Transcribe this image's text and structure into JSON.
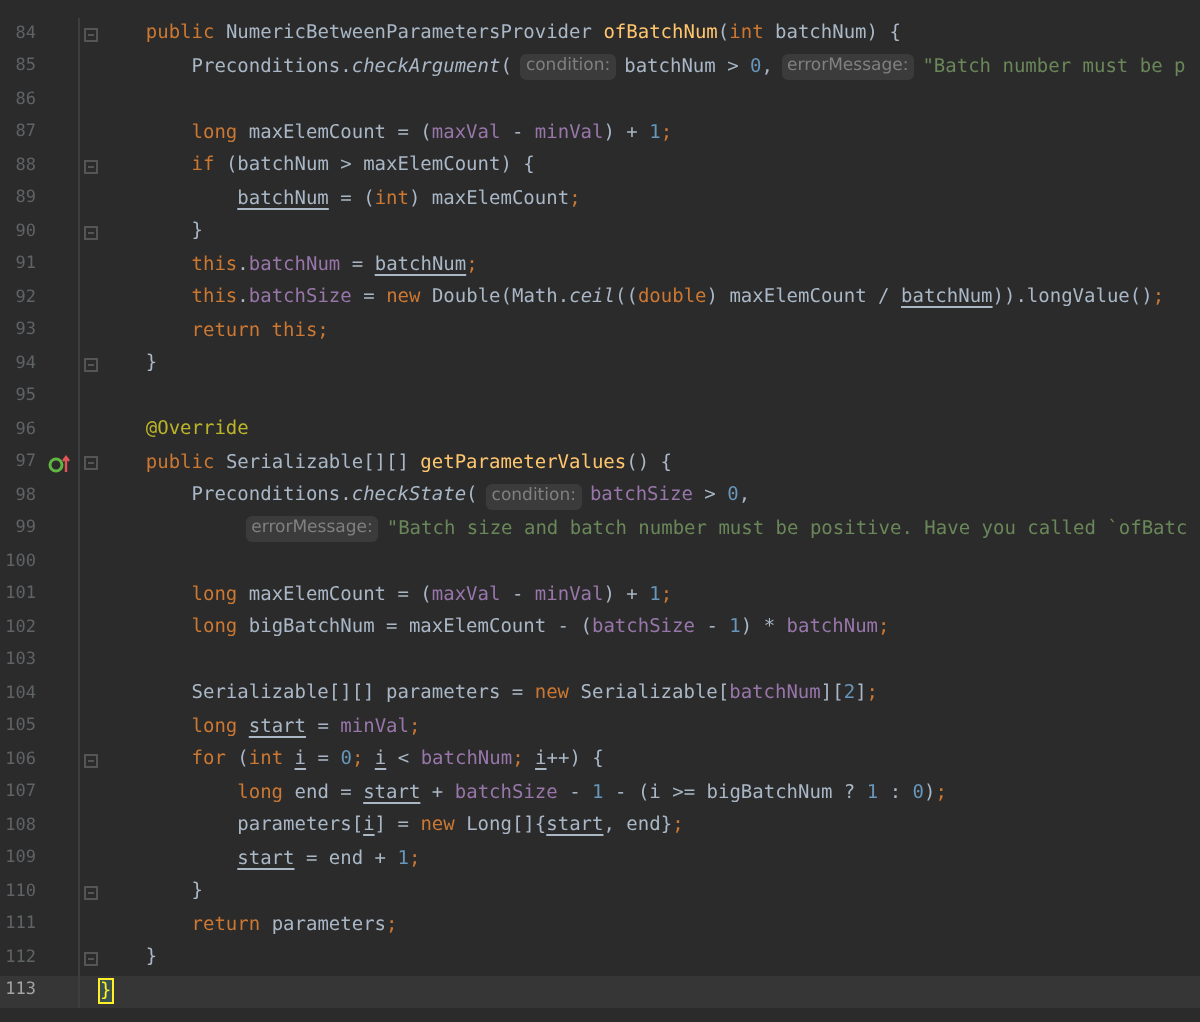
{
  "editor": {
    "lines": [
      {
        "number": "84",
        "fold": true,
        "current": false,
        "tokens": [
          {
            "kind": "keyword",
            "text": "    public "
          },
          {
            "kind": "plain",
            "text": "NumericBetweenParametersProvider "
          },
          {
            "kind": "method",
            "text": "ofBatchNum"
          },
          {
            "kind": "plain",
            "text": "("
          },
          {
            "kind": "keyword",
            "text": "int "
          },
          {
            "kind": "plain",
            "text": "batchNum) {"
          }
        ]
      },
      {
        "number": "85",
        "fold": false,
        "current": false,
        "tokens": [
          {
            "kind": "plain",
            "text": "        Preconditions."
          },
          {
            "kind": "static",
            "text": "checkArgument"
          },
          {
            "kind": "plain",
            "text": "("
          },
          {
            "kind": "hint",
            "text": "condition:"
          },
          {
            "kind": "plain",
            "text": "batchNum > "
          },
          {
            "kind": "number",
            "text": "0"
          },
          {
            "kind": "plain",
            "text": ","
          },
          {
            "kind": "hint",
            "text": "errorMessage:"
          },
          {
            "kind": "string",
            "text": "\"Batch number must be p"
          }
        ]
      },
      {
        "number": "86",
        "fold": false,
        "current": false
      },
      {
        "number": "87",
        "fold": false,
        "current": false,
        "tokens": [
          {
            "kind": "keyword",
            "text": "        long "
          },
          {
            "kind": "plain",
            "text": "maxElemCount = ("
          },
          {
            "kind": "field",
            "text": "maxVal"
          },
          {
            "kind": "plain",
            "text": " - "
          },
          {
            "kind": "field",
            "text": "minVal"
          },
          {
            "kind": "plain",
            "text": ") + "
          },
          {
            "kind": "number",
            "text": "1"
          },
          {
            "kind": "keyword",
            "text": ";"
          }
        ]
      },
      {
        "number": "88",
        "fold": true,
        "current": false,
        "tokens": [
          {
            "kind": "keyword",
            "text": "        if "
          },
          {
            "kind": "plain",
            "text": "(batchNum > maxElemCount) {"
          }
        ]
      },
      {
        "number": "89",
        "fold": false,
        "current": false,
        "tokens": [
          {
            "kind": "reassigned",
            "text": "            batchNum"
          },
          {
            "kind": "plain",
            "text": " = ("
          },
          {
            "kind": "keyword",
            "text": "int"
          },
          {
            "kind": "plain",
            "text": ") maxElemCount"
          },
          {
            "kind": "keyword",
            "text": ";"
          }
        ]
      },
      {
        "number": "90",
        "fold": true,
        "current": false,
        "tokens": [
          {
            "kind": "plain",
            "text": "        }"
          }
        ]
      },
      {
        "number": "91",
        "fold": false,
        "current": false,
        "tokens": [
          {
            "kind": "keyword",
            "text": "        this"
          },
          {
            "kind": "plain",
            "text": "."
          },
          {
            "kind": "field",
            "text": "batchNum"
          },
          {
            "kind": "plain",
            "text": " = "
          },
          {
            "kind": "reassigned",
            "text": "batchNum"
          },
          {
            "kind": "keyword",
            "text": ";"
          }
        ]
      },
      {
        "number": "92",
        "fold": false,
        "current": false,
        "tokens": [
          {
            "kind": "keyword",
            "text": "        this"
          },
          {
            "kind": "plain",
            "text": "."
          },
          {
            "kind": "field",
            "text": "batchSize"
          },
          {
            "kind": "plain",
            "text": " = "
          },
          {
            "kind": "keyword",
            "text": "new "
          },
          {
            "kind": "plain",
            "text": "Double(Math."
          },
          {
            "kind": "static",
            "text": "ceil"
          },
          {
            "kind": "plain",
            "text": "(("
          },
          {
            "kind": "keyword",
            "text": "double"
          },
          {
            "kind": "plain",
            "text": ") maxElemCount / "
          },
          {
            "kind": "reassigned",
            "text": "batchNum"
          },
          {
            "kind": "plain",
            "text": ")).longValue()"
          },
          {
            "kind": "keyword",
            "text": ";"
          }
        ]
      },
      {
        "number": "93",
        "fold": false,
        "current": false,
        "tokens": [
          {
            "kind": "keyword",
            "text": "        return this;"
          }
        ]
      },
      {
        "number": "94",
        "fold": true,
        "current": false,
        "tokens": [
          {
            "kind": "plain",
            "text": "    }"
          }
        ]
      },
      {
        "number": "95",
        "fold": false,
        "current": false
      },
      {
        "number": "96",
        "fold": false,
        "current": false,
        "tokens": [
          {
            "kind": "annotation",
            "text": "    @Override"
          }
        ]
      },
      {
        "number": "97",
        "fold": true,
        "current": false,
        "override": true,
        "tokens": [
          {
            "kind": "keyword",
            "text": "    public "
          },
          {
            "kind": "plain",
            "text": "Serializable[][] "
          },
          {
            "kind": "method",
            "text": "getParameterValues"
          },
          {
            "kind": "plain",
            "text": "() {"
          }
        ]
      },
      {
        "number": "98",
        "fold": false,
        "current": false,
        "tokens": [
          {
            "kind": "plain",
            "text": "        Preconditions."
          },
          {
            "kind": "static",
            "text": "checkState"
          },
          {
            "kind": "plain",
            "text": "("
          },
          {
            "kind": "hint",
            "text": "condition:"
          },
          {
            "kind": "field",
            "text": "batchSize"
          },
          {
            "kind": "plain",
            "text": " > "
          },
          {
            "kind": "number",
            "text": "0"
          },
          {
            "kind": "plain",
            "text": ","
          }
        ]
      },
      {
        "number": "99",
        "fold": false,
        "current": false,
        "tokens": [
          {
            "kind": "hint",
            "text": "            errorMessage:"
          },
          {
            "kind": "string",
            "text": "\"Batch size and batch number must be positive. Have you called `ofBatc"
          }
        ]
      },
      {
        "number": "100",
        "fold": false,
        "current": false
      },
      {
        "number": "101",
        "fold": false,
        "current": false,
        "tokens": [
          {
            "kind": "keyword",
            "text": "        long "
          },
          {
            "kind": "plain",
            "text": "maxElemCount = ("
          },
          {
            "kind": "field",
            "text": "maxVal"
          },
          {
            "kind": "plain",
            "text": " - "
          },
          {
            "kind": "field",
            "text": "minVal"
          },
          {
            "kind": "plain",
            "text": ") + "
          },
          {
            "kind": "number",
            "text": "1"
          },
          {
            "kind": "keyword",
            "text": ";"
          }
        ]
      },
      {
        "number": "102",
        "fold": false,
        "current": false,
        "tokens": [
          {
            "kind": "keyword",
            "text": "        long "
          },
          {
            "kind": "plain",
            "text": "bigBatchNum = maxElemCount - ("
          },
          {
            "kind": "field",
            "text": "batchSize"
          },
          {
            "kind": "plain",
            "text": " - "
          },
          {
            "kind": "number",
            "text": "1"
          },
          {
            "kind": "plain",
            "text": ") * "
          },
          {
            "kind": "field",
            "text": "batchNum"
          },
          {
            "kind": "keyword",
            "text": ";"
          }
        ]
      },
      {
        "number": "103",
        "fold": false,
        "current": false
      },
      {
        "number": "104",
        "fold": false,
        "current": false,
        "tokens": [
          {
            "kind": "plain",
            "text": "        Serializable[][] parameters = "
          },
          {
            "kind": "keyword",
            "text": "new "
          },
          {
            "kind": "plain",
            "text": "Serializable["
          },
          {
            "kind": "field",
            "text": "batchNum"
          },
          {
            "kind": "plain",
            "text": "]["
          },
          {
            "kind": "number",
            "text": "2"
          },
          {
            "kind": "plain",
            "text": "]"
          },
          {
            "kind": "keyword",
            "text": ";"
          }
        ]
      },
      {
        "number": "105",
        "fold": false,
        "current": false,
        "tokens": [
          {
            "kind": "keyword",
            "text": "        long "
          },
          {
            "kind": "reassigned",
            "text": "start"
          },
          {
            "kind": "plain",
            "text": " = "
          },
          {
            "kind": "field",
            "text": "minVal"
          },
          {
            "kind": "keyword",
            "text": ";"
          }
        ]
      },
      {
        "number": "106",
        "fold": true,
        "current": false,
        "tokens": [
          {
            "kind": "keyword",
            "text": "        for "
          },
          {
            "kind": "plain",
            "text": "("
          },
          {
            "kind": "keyword",
            "text": "int "
          },
          {
            "kind": "reassigned",
            "text": "i"
          },
          {
            "kind": "plain",
            "text": " = "
          },
          {
            "kind": "number",
            "text": "0"
          },
          {
            "kind": "keyword",
            "text": "; "
          },
          {
            "kind": "reassigned",
            "text": "i"
          },
          {
            "kind": "plain",
            "text": " < "
          },
          {
            "kind": "field",
            "text": "batchNum"
          },
          {
            "kind": "keyword",
            "text": "; "
          },
          {
            "kind": "reassigned",
            "text": "i"
          },
          {
            "kind": "plain",
            "text": "++) {"
          }
        ]
      },
      {
        "number": "107",
        "fold": false,
        "current": false,
        "tokens": [
          {
            "kind": "keyword",
            "text": "            long "
          },
          {
            "kind": "plain",
            "text": "end = "
          },
          {
            "kind": "reassigned",
            "text": "start"
          },
          {
            "kind": "plain",
            "text": " + "
          },
          {
            "kind": "field",
            "text": "batchSize"
          },
          {
            "kind": "plain",
            "text": " - "
          },
          {
            "kind": "number",
            "text": "1"
          },
          {
            "kind": "plain",
            "text": " - (i >= bigBatchNum ? "
          },
          {
            "kind": "number",
            "text": "1"
          },
          {
            "kind": "plain",
            "text": " : "
          },
          {
            "kind": "number",
            "text": "0"
          },
          {
            "kind": "plain",
            "text": ")"
          },
          {
            "kind": "keyword",
            "text": ";"
          }
        ]
      },
      {
        "number": "108",
        "fold": false,
        "current": false,
        "tokens": [
          {
            "kind": "plain",
            "text": "            parameters["
          },
          {
            "kind": "reassigned",
            "text": "i"
          },
          {
            "kind": "plain",
            "text": "] = "
          },
          {
            "kind": "keyword",
            "text": "new "
          },
          {
            "kind": "plain",
            "text": "Long[]{"
          },
          {
            "kind": "reassigned",
            "text": "start"
          },
          {
            "kind": "plain",
            "text": ", end}"
          },
          {
            "kind": "keyword",
            "text": ";"
          }
        ]
      },
      {
        "number": "109",
        "fold": false,
        "current": false,
        "tokens": [
          {
            "kind": "reassigned",
            "text": "            start"
          },
          {
            "kind": "plain",
            "text": " = end + "
          },
          {
            "kind": "number",
            "text": "1"
          },
          {
            "kind": "keyword",
            "text": ";"
          }
        ]
      },
      {
        "number": "110",
        "fold": true,
        "current": false,
        "tokens": [
          {
            "kind": "plain",
            "text": "        }"
          }
        ]
      },
      {
        "number": "111",
        "fold": false,
        "current": false,
        "tokens": [
          {
            "kind": "keyword",
            "text": "        return "
          },
          {
            "kind": "plain",
            "text": "parameters"
          },
          {
            "kind": "keyword",
            "text": ";"
          }
        ]
      },
      {
        "number": "112",
        "fold": true,
        "current": false,
        "tokens": [
          {
            "kind": "plain",
            "text": "    }"
          }
        ]
      },
      {
        "number": "113",
        "fold": false,
        "current": true,
        "tokens": [
          {
            "kind": "matched_brace",
            "text": "}"
          }
        ]
      }
    ]
  }
}
